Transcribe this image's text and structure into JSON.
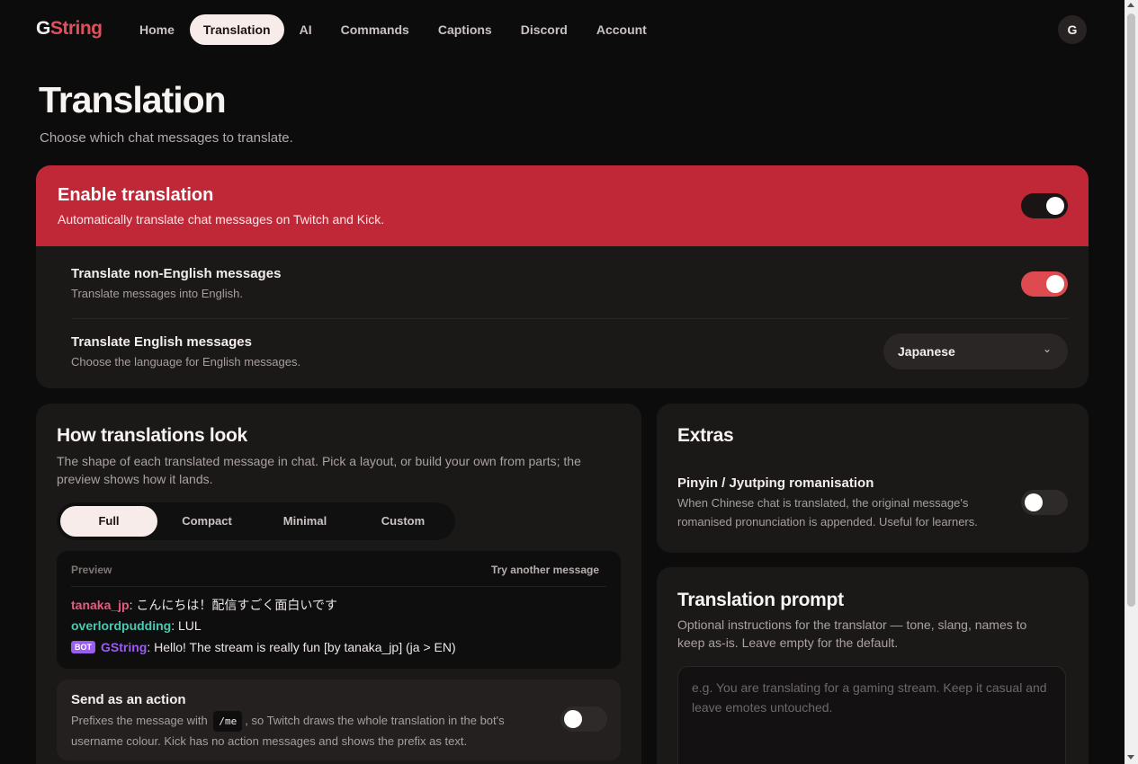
{
  "nav": {
    "logo_g": "G",
    "logo_rest": "String",
    "links": [
      {
        "label": "Home"
      },
      {
        "label": "Translation"
      },
      {
        "label": "AI"
      },
      {
        "label": "Commands"
      },
      {
        "label": "Captions"
      },
      {
        "label": "Discord"
      },
      {
        "label": "Account"
      }
    ],
    "active": "Translation",
    "avatar_initial": "G"
  },
  "header": {
    "title": "Translation",
    "subtitle": "Choose which chat messages to translate."
  },
  "enable": {
    "title": "Enable translation",
    "description": "Automatically translate chat messages on Twitch and Kick.",
    "enabled": true,
    "non_english": {
      "title": "Translate non-English messages",
      "description": "Translate messages into English.",
      "enabled": true
    },
    "english": {
      "title": "Translate English messages",
      "description": "Choose the language for English messages.",
      "selected_language": "Japanese",
      "chevron": "⌄"
    }
  },
  "how": {
    "title": "How translations look",
    "description": "The shape of each translated message in chat. Pick a layout, or build your own from parts; the preview shows how it lands.",
    "layouts": [
      "Full",
      "Compact",
      "Minimal",
      "Custom"
    ],
    "selected_layout": "Full",
    "preview": {
      "label": "Preview",
      "try_another": "Try another message",
      "lines": [
        {
          "user": "tanaka_jp",
          "text": ": こんにちは！配信すごく面白いです"
        },
        {
          "user": "overlordpudding",
          "text": ": LUL"
        },
        {
          "badge": "BOT",
          "user": "GString",
          "text": ": Hello! The stream is really fun [by tanaka_jp] (ja > EN)"
        }
      ]
    },
    "action": {
      "title": "Send as an action",
      "desc_before": "Prefixes the message with",
      "code": "/me",
      "desc_after": ", so Twitch draws the whole translation in the bot's",
      "desc_line2": "username colour. Kick has no action messages and shows the prefix as text.",
      "enabled": false
    }
  },
  "extras": {
    "title": "Extras",
    "romanisation": {
      "title": "Pinyin / Jyutping romanisation",
      "desc_line1": "When Chinese chat is translated, the original message's",
      "desc_line2": "romanised pronunciation is appended. Useful for learners.",
      "enabled": false
    }
  },
  "prompt": {
    "title": "Translation prompt",
    "desc_line1": "Optional instructions for the translator — tone, slang, names to",
    "desc_line2": "keep as-is. Leave empty for the default.",
    "value": "",
    "placeholder": "e.g. You are translating for a gaming stream. Keep it casual and leave emotes untouched."
  },
  "colors": {
    "accent": "#c02838",
    "toggle_on": "#df4a51",
    "background": "#0d0c0c",
    "card": "#1b1818"
  }
}
